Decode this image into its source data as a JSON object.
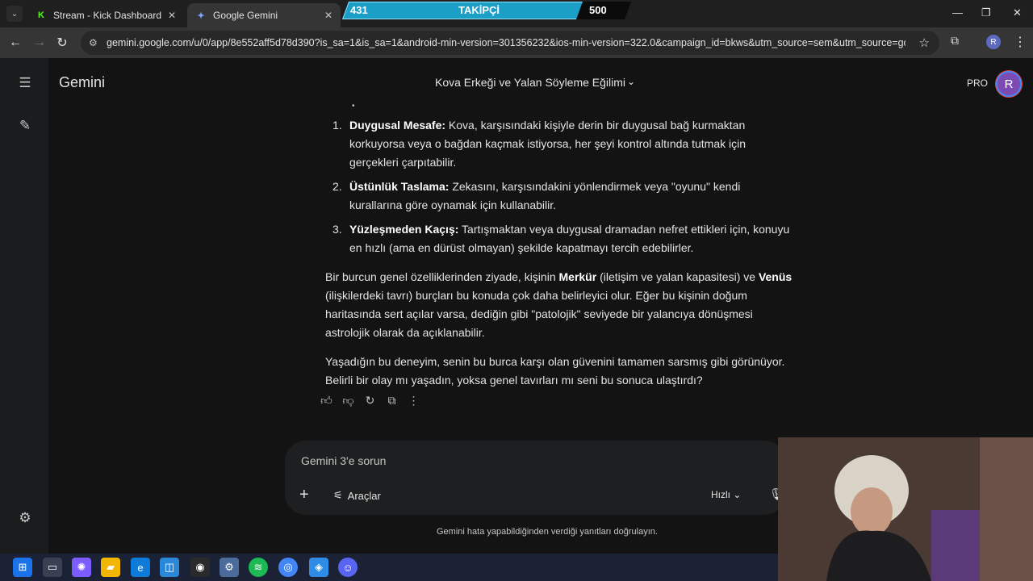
{
  "browser": {
    "tabs": [
      {
        "label": "Stream - Kick Dashboard",
        "favicon": "K",
        "close": "✕"
      },
      {
        "label": "Google Gemini",
        "favicon": "✦",
        "close": "✕"
      }
    ],
    "tab_dropdown": "⌄",
    "url": "gemini.google.com/u/0/app/8e552aff5d78d390?is_sa=1&is_sa=1&android-min-version=301356232&ios-min-version=322.0&campaign_id=bkws&utm_source=sem&utm_source=google&ut...",
    "profile_initial": "R",
    "window_controls": {
      "minimize": "—",
      "restore": "❐",
      "close": "✕"
    }
  },
  "stream_overlay": {
    "left_count": "431",
    "label": "TAKİPÇİ",
    "right_count": "500"
  },
  "gemini": {
    "brand": "Gemini",
    "chat_title": "Kova Erkeği ve Yalan Söyleme Eğilimi",
    "pro_label": "PRO",
    "avatar_initial": "R",
    "list_items": [
      {
        "num": "1.",
        "bold": "Duygusal Mesafe:",
        "text": " Kova, karşısındaki kişiyle derin bir duygusal bağ kurmaktan korkuyorsa veya o bağdan kaçmak istiyorsa, her şeyi kontrol altında tutmak için gerçekleri çarpıtabilir."
      },
      {
        "num": "2.",
        "bold": "Üstünlük Taslama:",
        "text": " Zekasını, karşısındakini yönlendirmek veya \"oyunu\" kendi kurallarına göre oynamak için kullanabilir."
      },
      {
        "num": "3.",
        "bold": "Yüzleşmeden Kaçış:",
        "text": " Tartışmaktan veya duygusal dramadan nefret ettikleri için, konuyu en hızlı (ama en dürüst olmayan) şekilde kapatmayı tercih edebilirler."
      }
    ],
    "para1": {
      "a": "Bir burcun genel özelliklerinden ziyade, kişinin ",
      "b1": "Merkür",
      "c": " (iletişim ve yalan kapasitesi) ve ",
      "b2": "Venüs",
      "d": " (ilişkilerdeki tavrı) burçları bu konuda çok daha belirleyici olur. Eğer bu kişinin doğum haritasında sert açılar varsa, dediğin gibi \"patolojik\" seviyede bir yalancıya dönüşmesi astrolojik olarak da açıklanabilir."
    },
    "para2": "Yaşadığın bu deneyim, senin bu burca karşı olan güvenini tamamen sarsmış gibi görünüyor. Belirli bir olay mı yaşadın, yoksa genel tavırları mı seni bu sonuca ulaştırdı?",
    "composer": {
      "placeholder": "Gemini 3'e sorun",
      "tools_label": "Araçlar",
      "speed_label": "Hızlı"
    },
    "disclaimer": "Gemini hata yapabildiğinden verdiği yanıtları doğrulayın."
  },
  "colors": {
    "background": "#131314",
    "sidebar": "#1b1c1d",
    "composer": "#1e1f20",
    "overlay_accent": "#1c9fc7"
  }
}
